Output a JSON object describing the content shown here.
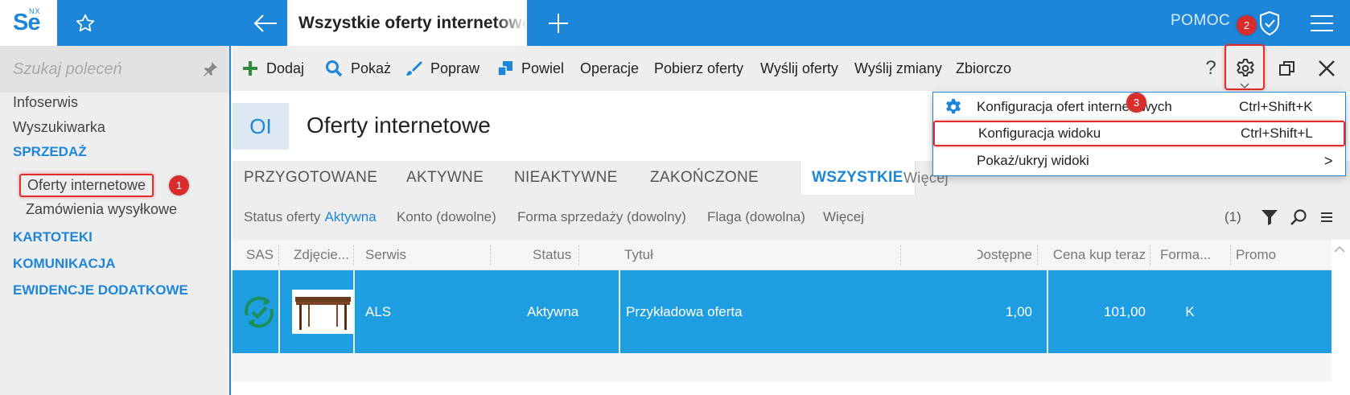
{
  "colors": {
    "accent": "#1e86d9",
    "row_selected": "#1e9de0",
    "callout": "#d92c2c",
    "highlight": "#e02d2d",
    "add_icon": "#2e8b3a"
  },
  "topbar": {
    "logo_text": "Se",
    "logo_superscript": "NX",
    "active_tab_title": "Wszystkie oferty internetowe",
    "help_label": "POMOC",
    "icons": [
      "star-icon",
      "back-arrow-icon",
      "plus-icon",
      "shield-check-icon",
      "hamburger-menu-icon"
    ]
  },
  "sidebar": {
    "search_placeholder": "Szukaj poleceń",
    "items": [
      {
        "label": "Infoserwis",
        "type": "item"
      },
      {
        "label": "Wyszukiwarka",
        "type": "item"
      },
      {
        "label": "SPRZEDAŻ",
        "type": "section"
      },
      {
        "label": "Oferty internetowe",
        "type": "sub",
        "selected": true
      },
      {
        "label": "Zamówienia wysyłkowe",
        "type": "sub"
      },
      {
        "label": "KARTOTEKI",
        "type": "section"
      },
      {
        "label": "KOMUNIKACJA",
        "type": "section"
      },
      {
        "label": "EWIDENCJE DODATKOWE",
        "type": "section"
      }
    ]
  },
  "callouts": [
    "1",
    "2",
    "3"
  ],
  "toolbar": {
    "buttons": [
      {
        "label": "Dodaj",
        "icon": "plus-icon"
      },
      {
        "label": "Pokaż",
        "icon": "magnifier-icon"
      },
      {
        "label": "Popraw",
        "icon": "brush-icon"
      },
      {
        "label": "Powiel",
        "icon": "duplicate-icon"
      },
      {
        "label": "Operacje"
      },
      {
        "label": "Pobierz oferty"
      },
      {
        "label": "Wyślij oferty"
      },
      {
        "label": "Wyślij zmiany"
      },
      {
        "label": "Zbiorczo"
      }
    ],
    "help_label": "?",
    "right_icons": [
      "gear-icon",
      "restore-window-icon",
      "close-icon"
    ]
  },
  "page": {
    "abbr": "OI",
    "title": "Oferty internetowe"
  },
  "tabs": {
    "items": [
      "PRZYGOTOWANE",
      "AKTYWNE",
      "NIEAKTYWNE",
      "ZAKOŃCZONE",
      "WSZYSTKIE",
      "Więcej"
    ],
    "active": "WSZYSTKIE"
  },
  "filters": {
    "status_label": "Status oferty",
    "status_value": "Aktywna",
    "others": [
      "Konto (dowolne)",
      "Forma sprzedaży (dowolny)",
      "Flaga (dowolna)",
      "Więcej"
    ],
    "count": "(1)",
    "icons": [
      "filter-icon",
      "search-icon",
      "list-icon"
    ]
  },
  "grid": {
    "columns": [
      "SAS",
      "Zdjęcie...",
      "Serwis",
      "Status",
      "Tytuł",
      "Dostępne",
      "Cena kup teraz",
      "Forma...",
      "Promo"
    ],
    "rows": [
      {
        "sas_icon": "sync-check-icon",
        "photo": "table-thumbnail",
        "serwis": "ALS",
        "status": "Aktywna",
        "tytul": "Przykładowa oferta",
        "dostepne": "1,00",
        "cena": "101,00",
        "forma": "K",
        "promo": ""
      }
    ]
  },
  "dropdown": {
    "items": [
      {
        "label": "Konfiguracja ofert internetowych",
        "shortcut": "Ctrl+Shift+K",
        "icon": "gear-icon"
      },
      {
        "label": "Konfiguracja widoku",
        "shortcut": "Ctrl+Shift+L",
        "highlighted": true
      },
      {
        "label": "Pokaż/ukryj widoki",
        "submenu": ">"
      }
    ]
  }
}
